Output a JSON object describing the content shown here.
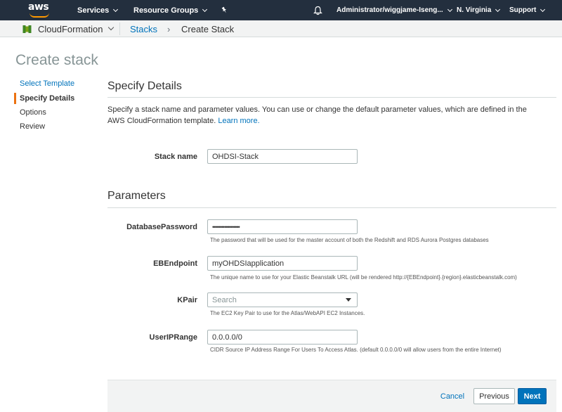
{
  "topnav": {
    "logo_text": "aws",
    "services": "Services",
    "resource_groups": "Resource Groups",
    "account": "Administrator/wiggjame-Iseng...",
    "region": "N. Virginia",
    "support": "Support"
  },
  "subnav": {
    "service": "CloudFormation",
    "breadcrumb_parent": "Stacks",
    "breadcrumb_sep": "›",
    "breadcrumb_current": "Create Stack"
  },
  "page": {
    "title": "Create stack"
  },
  "steps": {
    "items": [
      {
        "label": "Select Template"
      },
      {
        "label": "Specify Details"
      },
      {
        "label": "Options"
      },
      {
        "label": "Review"
      }
    ]
  },
  "details": {
    "title": "Specify Details",
    "description": "Specify a stack name and parameter values. You can use or change the default parameter values, which are defined in the AWS CloudFormation template.",
    "learn_more": "Learn more.",
    "stack_name_label": "Stack name",
    "stack_name_value": "OHDSI-Stack"
  },
  "parameters": {
    "title": "Parameters",
    "fields": [
      {
        "label": "DatabasePassword",
        "value": "••••••••••••••••••",
        "help": "The password that will be used for the master account of both the Redshift and RDS Aurora Postgres databases"
      },
      {
        "label": "EBEndpoint",
        "value": "myOHDSIapplication",
        "help": "The unique name to use for your Elastic Beanstalk URL (will be rendered http://{EBEndpoint}.{region}.elasticbeanstalk.com)"
      },
      {
        "label": "KPair",
        "placeholder": "Search",
        "help": "The EC2 Key Pair to use for the Atlas/WebAPI EC2 Instances."
      },
      {
        "label": "UserIPRange",
        "value": "0.0.0.0/0",
        "help": "CIDR Source IP Address Range For Users To Access Atlas. (default 0.0.0.0/0 will allow users from the entire Internet)"
      }
    ]
  },
  "footer": {
    "cancel": "Cancel",
    "previous": "Previous",
    "next": "Next"
  },
  "colors": {
    "nav_bg": "#232f3e",
    "accent": "#ff9900",
    "link": "#0073bb",
    "primary_button": "#0073bb",
    "active_step_bar": "#ec7211"
  }
}
